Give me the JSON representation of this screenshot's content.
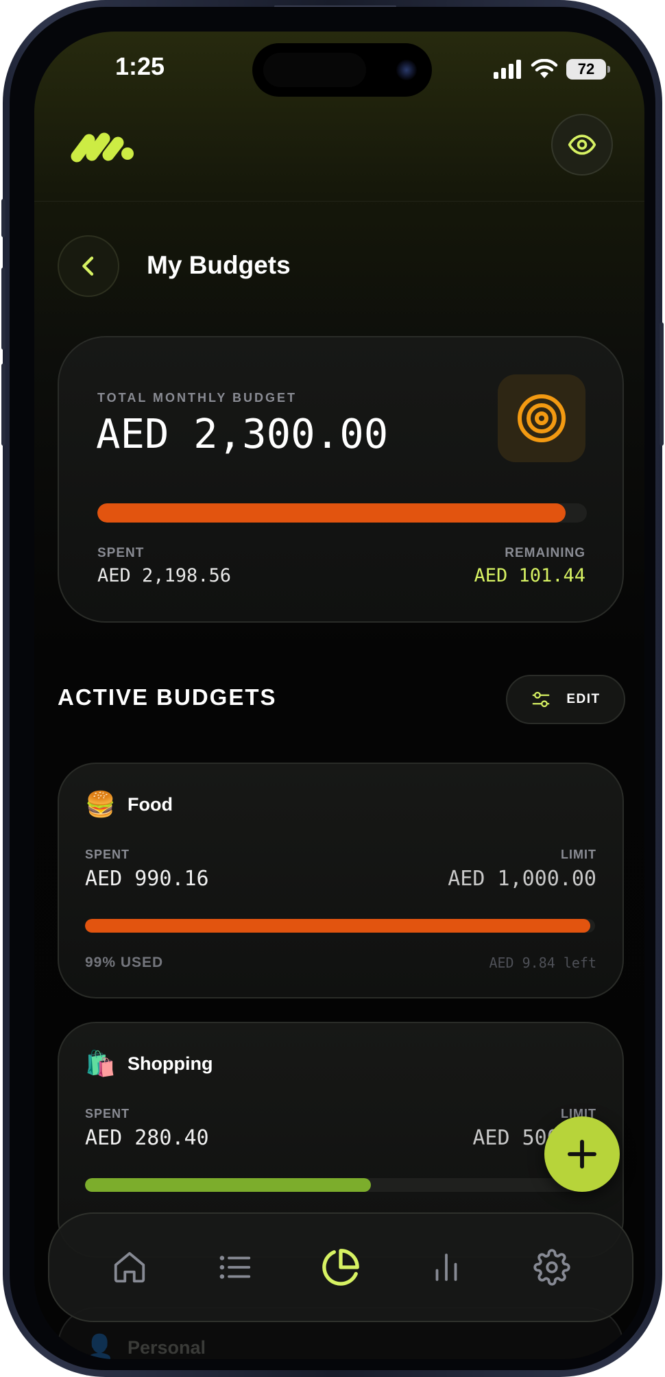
{
  "status_bar": {
    "time": "1:25",
    "battery_level": "72",
    "icons": [
      "cellular-signal-icon",
      "wifi-icon",
      "battery-icon"
    ]
  },
  "header": {
    "logo": "m-logo-icon",
    "toggle_visibility_icon": "eye-icon"
  },
  "page": {
    "back_icon": "chevron-left-icon",
    "title": "My Budgets"
  },
  "summary": {
    "label": "TOTAL MONTHLY BUDGET",
    "amount": "AED 2,300.00",
    "icon": "target-icon",
    "progress_fraction": 0.956,
    "spent_label": "SPENT",
    "spent_value": "AED 2,198.56",
    "remaining_label": "REMAINING",
    "remaining_value": "AED 101.44"
  },
  "active_budgets": {
    "title": "ACTIVE BUDGETS",
    "edit_label": "EDIT",
    "edit_icon": "sliders-icon",
    "items": [
      {
        "icon": "🍔",
        "name": "Food",
        "spent_label": "SPENT",
        "limit_label": "LIMIT",
        "spent": "AED 990.16",
        "limit": "AED 1,000.00",
        "progress_fraction": 0.99,
        "bar_color": "#e2540f",
        "used": "99% USED",
        "left": "AED 9.84 left"
      },
      {
        "icon": "🛍️",
        "name": "Shopping",
        "spent_label": "SPENT",
        "limit_label": "LIMIT",
        "spent": "AED 280.40",
        "limit": "AED 500.00",
        "progress_fraction": 0.56,
        "bar_color": "#7cad2c"
      }
    ],
    "peek_item": {
      "icon": "👤",
      "name": "Personal"
    }
  },
  "fab_icon": "plus-icon",
  "nav": {
    "items": [
      {
        "icon": "home-icon",
        "active": false
      },
      {
        "icon": "list-icon",
        "active": false
      },
      {
        "icon": "pie-chart-icon",
        "active": true
      },
      {
        "icon": "bar-chart-icon",
        "active": false
      },
      {
        "icon": "settings-gear-icon",
        "active": false
      }
    ]
  },
  "colors": {
    "accent": "#d7f263",
    "progress_orange": "#e2540f",
    "progress_green": "#7cad2c",
    "target_orange": "#f39a12",
    "muted_label": "#8a8c94"
  }
}
